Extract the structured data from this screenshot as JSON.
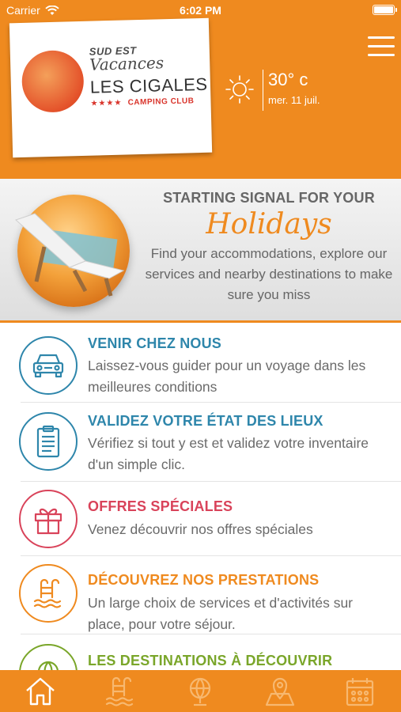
{
  "status_bar": {
    "carrier": "Carrier",
    "time": "6:02 PM"
  },
  "header": {
    "logo": {
      "brand_line1": "SUD EST",
      "brand_line2": "Vacances",
      "name": "LES CIGALES",
      "stars": "★★★★",
      "tagline": "CAMPING CLUB"
    },
    "weather": {
      "temperature": "30° c",
      "date": "mer. 11 juil.",
      "icon": "sun-icon"
    },
    "menu_icon": "hamburger-menu-icon"
  },
  "banner": {
    "headline": "STARTING SIGNAL FOR YOUR",
    "script_word": "Holidays",
    "description": "Find your accommodations, explore our services and nearby destinations to make sure you miss"
  },
  "list": {
    "items": [
      {
        "title": "VENIR CHEZ NOUS",
        "subtitle": "Laissez-vous guider pour un voyage dans les meilleures conditions",
        "color": "#2e86ab",
        "icon": "car-icon"
      },
      {
        "title": "VALIDEZ VOTRE ÉTAT DES LIEUX",
        "subtitle": "Vérifiez si tout y est et validez votre inventaire d'un simple clic.",
        "color": "#2e86ab",
        "icon": "clipboard-icon"
      },
      {
        "title": "OFFRES SPÉCIALES",
        "subtitle": "Venez découvrir nos offres spéciales",
        "color": "#d9435a",
        "icon": "gift-icon"
      },
      {
        "title": "DÉCOUVREZ NOS PRESTATIONS",
        "subtitle": "Un large choix de services et d'activités sur place, pour votre séjour.",
        "color": "#ef8a1f",
        "icon": "pool-ladder-icon"
      },
      {
        "title": "LES DESTINATIONS À DÉCOUVRIR",
        "subtitle": "",
        "color": "#7aa62a",
        "icon": "globe-icon"
      }
    ]
  },
  "tab_bar": {
    "tabs": [
      {
        "name": "home",
        "icon": "home-icon",
        "active": true
      },
      {
        "name": "services",
        "icon": "pool-ladder-icon",
        "active": false
      },
      {
        "name": "destinations",
        "icon": "globe-icon",
        "active": false
      },
      {
        "name": "map",
        "icon": "map-pin-icon",
        "active": false
      },
      {
        "name": "calendar",
        "icon": "calendar-icon",
        "active": false
      }
    ]
  },
  "colors": {
    "brand_orange": "#ef8a1f",
    "blue": "#2e86ab",
    "red": "#d9435a",
    "green": "#7aa62a"
  }
}
